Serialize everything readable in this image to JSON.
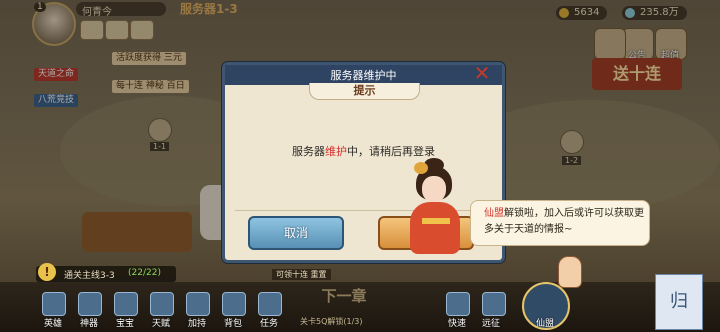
{
  "hud": {
    "player_level": "1",
    "player_name": "何青今",
    "top_logo": "服务器1-3",
    "currency1": "5634",
    "currency2": "235.8万",
    "side_labels": [
      "公告",
      "超值"
    ],
    "banner": "送十连"
  },
  "quests": {
    "tag1": "活跃度获得 三元",
    "tag2": "天道之命",
    "tag3": "每十连 神秘 百日",
    "tag4": "八荒竞技"
  },
  "map": {
    "node1": "1-1",
    "node2": "1-2"
  },
  "dialog": {
    "header": "服务器维护中",
    "subtitle": "提示",
    "message_pre": "服务器",
    "message_highlight": "维护",
    "message_post": "中，请稍后再登录",
    "cancel_label": "取消",
    "close_symbol": "✕"
  },
  "speech": {
    "highlight": "仙盟",
    "text": "解锁啦，加入后或许可以获取更多关于天道的情报~"
  },
  "bottom": {
    "quest_icon": "!",
    "quest_name": "通关主线3-3",
    "quest_progress": "(22/22)",
    "mid_tag": "可领十连 重置",
    "next_chapter": "下一章",
    "next_sub": "关卡5Q解锁(1/3)",
    "buttons": [
      "英雄",
      "神器",
      "宝宝",
      "天赋",
      "加持",
      "背包",
      "任务"
    ],
    "right_buttons": [
      "快速",
      "远征"
    ],
    "xianmeng": "仙盟",
    "gui": "归"
  },
  "colors": {
    "dialog_border": "#3f5671",
    "cancel_btn": "#5891b6",
    "confirm_btn": "#d88f3c",
    "highlight": "#d62e2e"
  }
}
